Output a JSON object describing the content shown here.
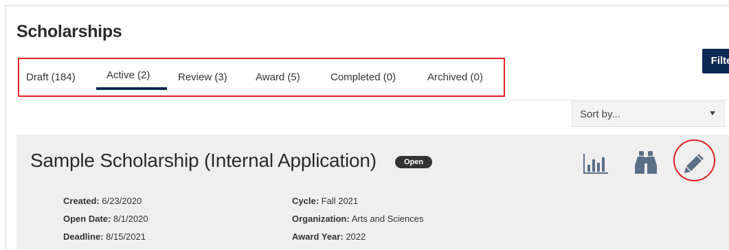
{
  "page": {
    "title": "Scholarships"
  },
  "toolbar": {
    "filter_label": "Filter"
  },
  "tabs": [
    {
      "label": "Draft (184)"
    },
    {
      "label": "Active (2)",
      "active": true
    },
    {
      "label": "Review (3)"
    },
    {
      "label": "Award (5)"
    },
    {
      "label": "Completed (0)"
    },
    {
      "label": "Archived (0)"
    }
  ],
  "sort": {
    "value": "Sort by..."
  },
  "card": {
    "title": "Sample Scholarship (Internal Application)",
    "status": "Open",
    "actions": [
      {
        "icon": "bar-chart-icon"
      },
      {
        "icon": "binoculars-icon"
      },
      {
        "icon": "pencil-icon"
      }
    ],
    "details_left": [
      {
        "label": "Created:",
        "value": "6/23/2020"
      },
      {
        "label": "Open Date:",
        "value": "8/1/2020"
      },
      {
        "label": "Deadline:",
        "value": "8/15/2021"
      }
    ],
    "details_right": [
      {
        "label": "Cycle:",
        "value": "Fall 2021"
      },
      {
        "label": "Organization:",
        "value": "Arts and Sciences"
      },
      {
        "label": "Award Year:",
        "value": "2022"
      }
    ]
  },
  "colors": {
    "primary": "#0d2a54",
    "highlight": "#e41e26",
    "card_bg": "#efefef",
    "icon": "#5b6f86"
  }
}
